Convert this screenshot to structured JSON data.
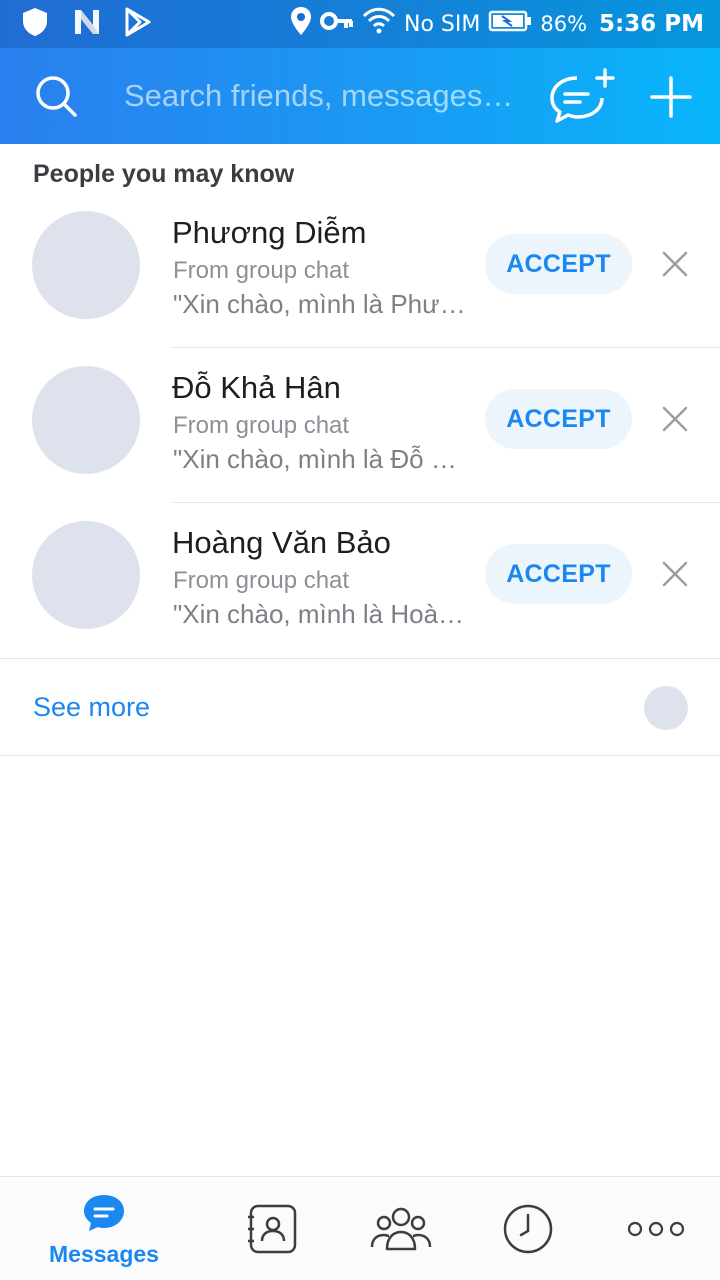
{
  "status_bar": {
    "icons": [
      "shield-icon",
      "n-logo-icon",
      "play-store-icon",
      "location-icon",
      "vpn-key-icon",
      "wifi-icon",
      "battery-icon"
    ],
    "sim_text": "No SIM",
    "battery_percent": "86%",
    "time": "5:36 PM"
  },
  "header": {
    "search_placeholder": "Search friends, messages…",
    "icons": [
      "search-icon",
      "new-chat-icon",
      "plus-icon"
    ],
    "accent_colors": [
      "#2a7fee",
      "#08b6fb"
    ]
  },
  "suggestions": {
    "title": "People you may know",
    "items": [
      {
        "name": "Phương Diễm",
        "source": "From group chat",
        "message": "\"Xin chào, mình là Phương Diễm\"",
        "accept_label": "ACCEPT"
      },
      {
        "name": "Đỗ Khả Hân",
        "source": "From group chat",
        "message": "\"Xin chào, mình là Đỗ Khả Hân\"",
        "accept_label": "ACCEPT"
      },
      {
        "name": "Hoàng Văn Bảo",
        "source": "From group chat",
        "message": "\"Xin chào, mình là Hoàng Văn Bảo\"",
        "accept_label": "ACCEPT"
      }
    ],
    "see_more_label": "See more"
  },
  "bottom_nav": {
    "items": [
      {
        "label": "Messages",
        "icon": "chat-bubble-icon",
        "active": true
      },
      {
        "label": "",
        "icon": "contacts-icon",
        "active": false
      },
      {
        "label": "",
        "icon": "group-icon",
        "active": false
      },
      {
        "label": "",
        "icon": "clock-icon",
        "active": false
      },
      {
        "label": "",
        "icon": "more-icon",
        "active": false
      }
    ],
    "active_color": "#1a88f0"
  }
}
